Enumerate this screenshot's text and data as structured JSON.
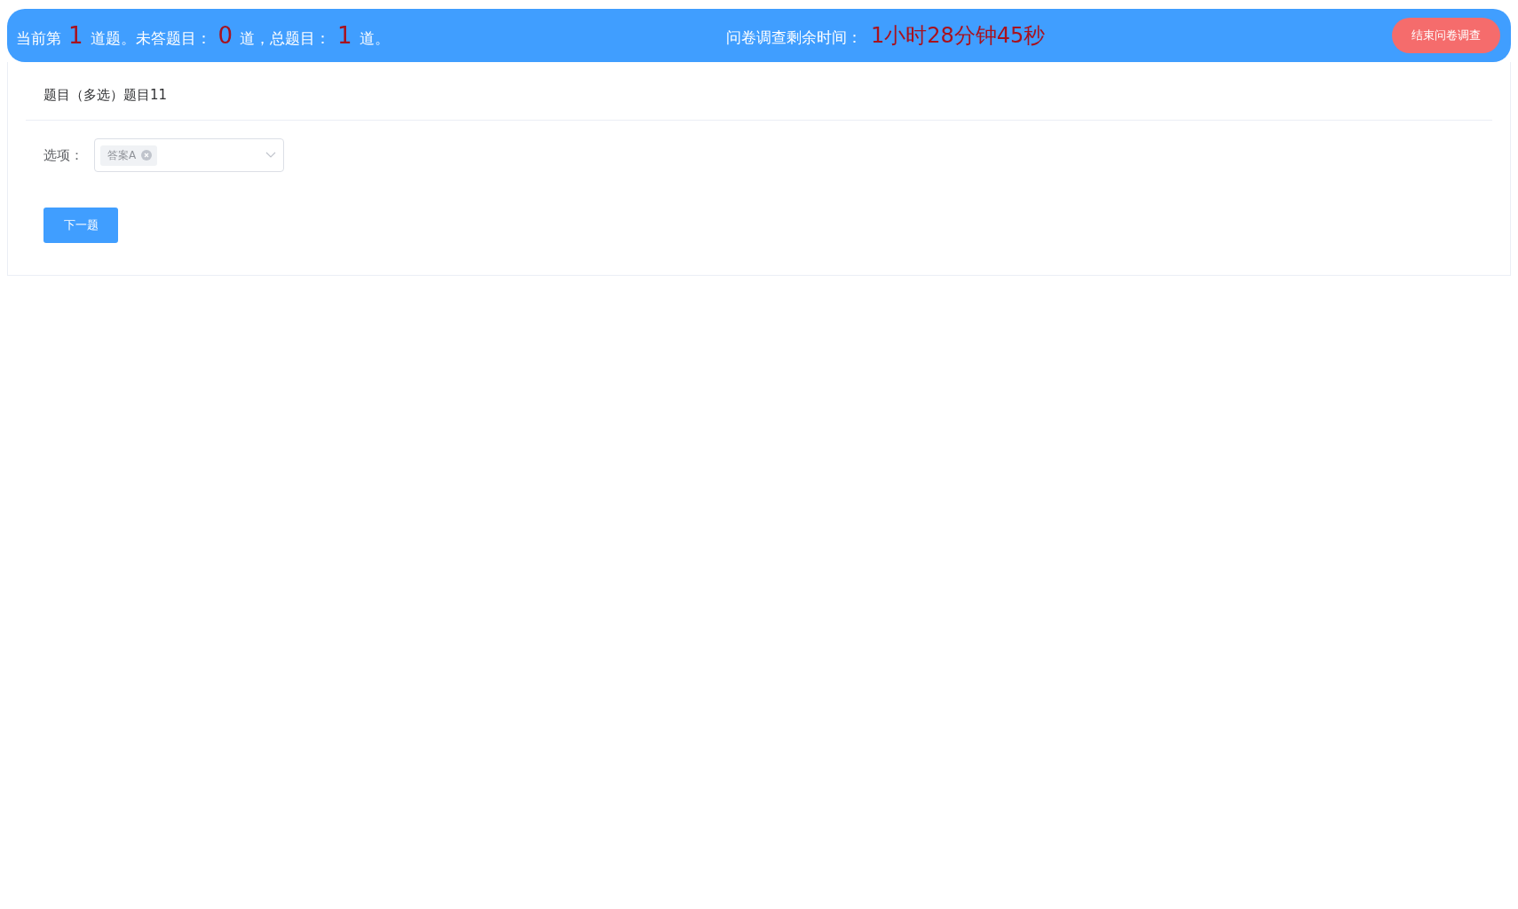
{
  "status_bar": {
    "progress": [
      {
        "kind": "text",
        "text": "当前第"
      },
      {
        "kind": "number",
        "text": "1"
      },
      {
        "kind": "text",
        "text": "道题。未答题目："
      },
      {
        "kind": "number",
        "text": "0"
      },
      {
        "kind": "text",
        "text": "道，总题目："
      },
      {
        "kind": "number",
        "text": "1"
      },
      {
        "kind": "text",
        "text": "道。"
      }
    ],
    "timer_label": "问卷调查剩余时间：",
    "timer_value": "1小时28分钟45秒",
    "end_button": "结束问卷调查"
  },
  "question": {
    "title": "题目（多选）题目11",
    "options_label": "选项：",
    "selected_tags": [
      "答案A"
    ],
    "next_button": "下一题"
  }
}
